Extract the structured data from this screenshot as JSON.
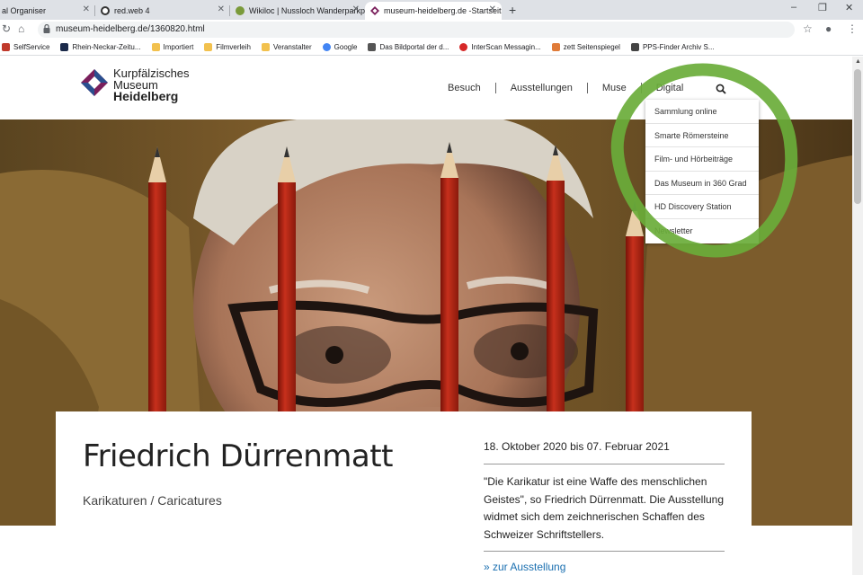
{
  "browser": {
    "tabs": [
      {
        "title": "al Organiser",
        "color": "#4a7fc1"
      },
      {
        "title": "red.web 4",
        "color": "#333333"
      },
      {
        "title": "Wikiloc | Nussloch Wanderparkpl",
        "color": "#7a9a3a"
      },
      {
        "title": "museum-heidelberg.de -Startseit",
        "color": "#7a1f5c"
      }
    ],
    "new_tab": "+",
    "window_controls": [
      "–",
      "❐",
      "✕"
    ],
    "url": "museum-heidelberg.de/1360820.html",
    "bookmarks": [
      {
        "label": "SelfService",
        "color": "#c0392b"
      },
      {
        "label": "Rhein-Neckar-Zeitu...",
        "color": "#1b2a4a"
      },
      {
        "label": "Importiert",
        "color": "#f2c14e"
      },
      {
        "label": "Filmverleih",
        "color": "#f2c14e"
      },
      {
        "label": "Veranstalter",
        "color": "#f2c14e"
      },
      {
        "label": "Google",
        "color": "#4285f4"
      },
      {
        "label": "Das Bildportal der d...",
        "color": "#555555"
      },
      {
        "label": "InterScan Messagin...",
        "color": "#d62828"
      },
      {
        "label": "zett Seitenspiegel",
        "color": "#e07b39"
      },
      {
        "label": "PPS-Finder Archiv S...",
        "color": "#444444"
      }
    ]
  },
  "site": {
    "logo": {
      "line1": "Kurpfälzisches",
      "line2": "Museum",
      "line3": "Heidelberg"
    },
    "nav": [
      "Besuch",
      "Ausstellungen",
      "Muse",
      "Digital"
    ],
    "dropdown": [
      "Sammlung online",
      "Smarte Römersteine",
      "Film- und Hörbeiträge",
      "Das Museum in 360 Grad",
      "HD Discovery Station",
      "Newsletter"
    ],
    "highlight_color": "#6aad3a"
  },
  "exhibition": {
    "title": "Friedrich Dürrenmatt",
    "subtitle": "Karikaturen / Caricatures",
    "dates": "18. Oktober 2020 bis 07. Februar 2021",
    "description": "\"Die Karikatur ist eine Waffe des menschlichen Geistes\", so Friedrich Dürrenmatt. Die Ausstellung widmet sich dem zeichnerischen Schaffen des Schweizer Schriftstellers.",
    "link": "» zur Ausstellung"
  }
}
